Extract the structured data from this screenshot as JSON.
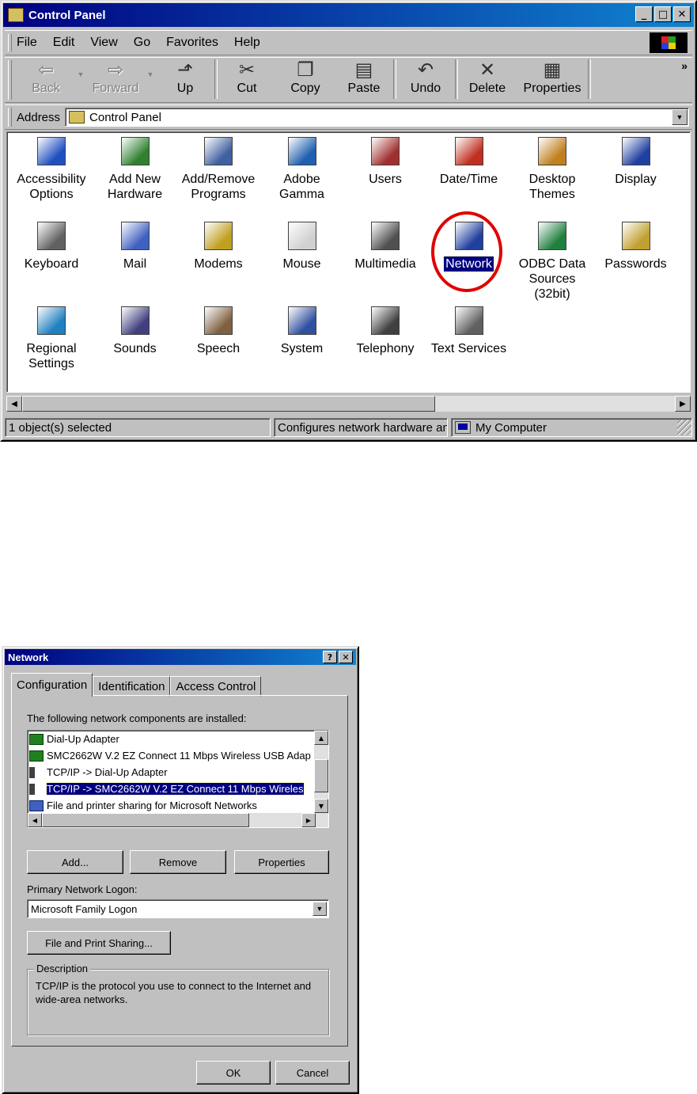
{
  "control_panel": {
    "title": "Control Panel",
    "menu": [
      "File",
      "Edit",
      "View",
      "Go",
      "Favorites",
      "Help"
    ],
    "toolbar": {
      "back": "Back",
      "forward": "Forward",
      "up": "Up",
      "cut": "Cut",
      "copy": "Copy",
      "paste": "Paste",
      "undo": "Undo",
      "delete": "Delete",
      "properties": "Properties"
    },
    "address_label": "Address",
    "address_value": "Control Panel",
    "icons": [
      {
        "label": "Accessibility Options",
        "icon": "accessibility-icon"
      },
      {
        "label": "Add New Hardware",
        "icon": "hardware-icon"
      },
      {
        "label": "Add/Remove Programs",
        "icon": "programs-icon"
      },
      {
        "label": "Adobe Gamma",
        "icon": "monitor-gamma-icon"
      },
      {
        "label": "Users",
        "icon": "users-icon"
      },
      {
        "label": "Date/Time",
        "icon": "calendar-clock-icon"
      },
      {
        "label": "Desktop Themes",
        "icon": "themes-icon"
      },
      {
        "label": "Display",
        "icon": "display-icon"
      },
      {
        "label": "Keyboard",
        "icon": "keyboard-icon"
      },
      {
        "label": "Mail",
        "icon": "mail-icon"
      },
      {
        "label": "Modems",
        "icon": "modem-phone-icon"
      },
      {
        "label": "Mouse",
        "icon": "mouse-icon"
      },
      {
        "label": "Multimedia",
        "icon": "multimedia-icon"
      },
      {
        "label": "Network",
        "icon": "network-icon",
        "selected": true
      },
      {
        "label": "ODBC Data Sources (32bit)",
        "icon": "odbc-icon"
      },
      {
        "label": "Passwords",
        "icon": "keys-icon"
      },
      {
        "label": "Regional Settings",
        "icon": "globe-icon"
      },
      {
        "label": "Sounds",
        "icon": "speaker-icon"
      },
      {
        "label": "Speech",
        "icon": "speech-icon"
      },
      {
        "label": "System",
        "icon": "computer-icon"
      },
      {
        "label": "Telephony",
        "icon": "telephony-icon"
      },
      {
        "label": "Text Services",
        "icon": "text-services-icon"
      }
    ],
    "status": {
      "selection": "1 object(s) selected",
      "description": "Configures network hardware an",
      "zone": "My Computer"
    }
  },
  "network_dialog": {
    "title": "Network",
    "tabs": [
      "Configuration",
      "Identification",
      "Access Control"
    ],
    "components_label": "The following network components are installed:",
    "components": [
      {
        "text": "Dial-Up Adapter",
        "icon": "network-card-icon"
      },
      {
        "text": "SMC2662W V.2 EZ Connect 11 Mbps Wireless USB Adap",
        "icon": "network-card-icon"
      },
      {
        "text": "TCP/IP -> Dial-Up Adapter",
        "icon": "protocol-icon"
      },
      {
        "text": "TCP/IP -> SMC2662W V.2 EZ Connect 11 Mbps Wireles",
        "icon": "protocol-icon",
        "selected": true
      },
      {
        "text": "File and printer sharing for Microsoft Networks",
        "icon": "sharing-service-icon"
      }
    ],
    "buttons": {
      "add": "Add...",
      "remove": "Remove",
      "properties": "Properties"
    },
    "logon_label": "Primary Network Logon:",
    "logon_value": "Microsoft Family Logon",
    "file_print_sharing": "File and Print Sharing...",
    "description_legend": "Description",
    "description_text": "TCP/IP is the protocol you use to connect to the Internet and wide-area networks.",
    "ok": "OK",
    "cancel": "Cancel"
  },
  "colors": {
    "title_active": "#000080",
    "window_face": "#c0c0c0",
    "highlight": "#000080",
    "annotation_circle": "#e00000"
  }
}
